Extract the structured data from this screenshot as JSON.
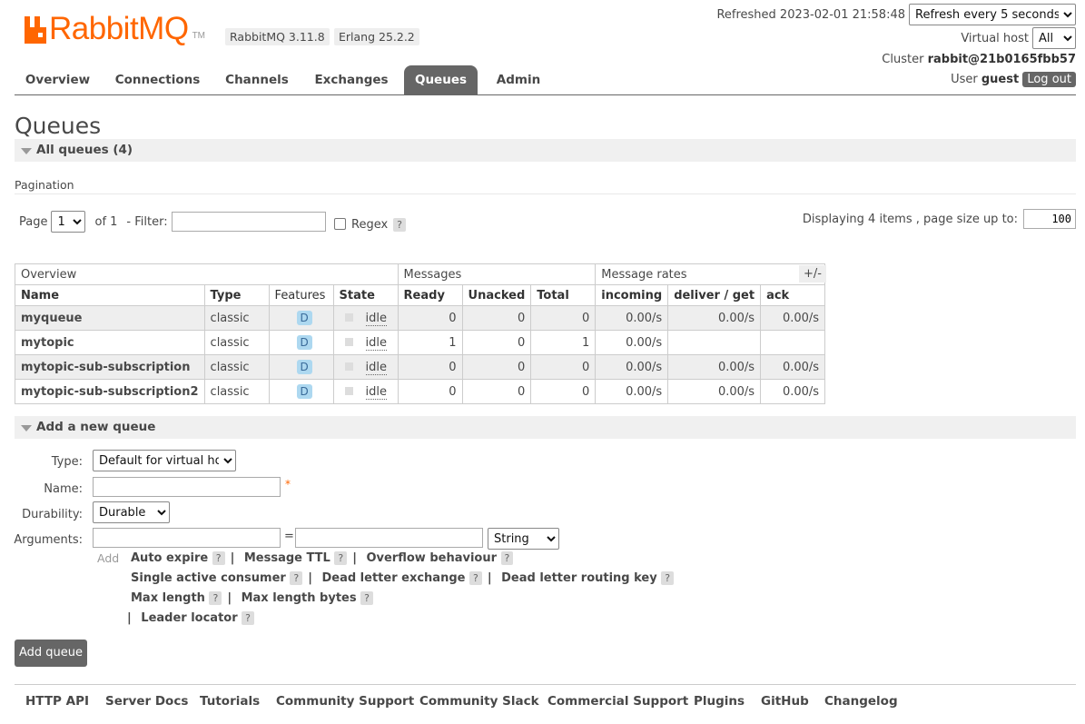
{
  "header": {
    "brand": "RabbitMQ",
    "tm": "TM",
    "rabbitmq_version": "RabbitMQ 3.11.8",
    "erlang_version": "Erlang 25.2.2",
    "refreshed": "Refreshed 2023-02-01 21:58:48",
    "refresh_option": "Refresh every 5 seconds",
    "vhost_label": "Virtual host",
    "vhost_value": "All",
    "cluster_label": "Cluster",
    "cluster_value": "rabbit@21b0165fbb57",
    "user_label": "User",
    "user_value": "guest",
    "logout": "Log out"
  },
  "tabs": [
    "Overview",
    "Connections",
    "Channels",
    "Exchanges",
    "Queues",
    "Admin"
  ],
  "active_tab": "Queues",
  "page_title": "Queues",
  "all_queues": {
    "label": "All queues (4)",
    "pagination_label": "Pagination",
    "page_label": "Page",
    "page_value": "1",
    "of_label": "of 1",
    "filter_label": "- Filter:",
    "filter_value": "",
    "regex_label": "Regex",
    "help": "?",
    "displaying": "Displaying 4 items , page size up to:",
    "page_size": "100",
    "plus_minus": "+/-"
  },
  "table": {
    "groups": [
      "Overview",
      "Messages",
      "Message rates"
    ],
    "columns": [
      "Name",
      "Type",
      "Features",
      "State",
      "Ready",
      "Unacked",
      "Total",
      "incoming",
      "deliver / get",
      "ack"
    ],
    "rows": [
      {
        "name": "myqueue",
        "type": "classic",
        "feature": "D",
        "state": "idle",
        "ready": "0",
        "unacked": "0",
        "total": "0",
        "incoming": "0.00/s",
        "deliver": "0.00/s",
        "ack": "0.00/s"
      },
      {
        "name": "mytopic",
        "type": "classic",
        "feature": "D",
        "state": "idle",
        "ready": "1",
        "unacked": "0",
        "total": "1",
        "incoming": "0.00/s",
        "deliver": "",
        "ack": ""
      },
      {
        "name": "mytopic-sub-subscription",
        "type": "classic",
        "feature": "D",
        "state": "idle",
        "ready": "0",
        "unacked": "0",
        "total": "0",
        "incoming": "0.00/s",
        "deliver": "0.00/s",
        "ack": "0.00/s"
      },
      {
        "name": "mytopic-sub-subscription2",
        "type": "classic",
        "feature": "D",
        "state": "idle",
        "ready": "0",
        "unacked": "0",
        "total": "0",
        "incoming": "0.00/s",
        "deliver": "0.00/s",
        "ack": "0.00/s"
      }
    ]
  },
  "add_queue": {
    "section_label": "Add a new queue",
    "type_label": "Type:",
    "type_value": "Default for virtual host",
    "name_label": "Name:",
    "name_value": "",
    "required_mark": "*",
    "durability_label": "Durability:",
    "durability_value": "Durable",
    "arguments_label": "Arguments:",
    "equals": "=",
    "arg_type_value": "String",
    "add_label": "Add",
    "arg_links_row1": [
      "Auto expire",
      "Message TTL",
      "Overflow behaviour"
    ],
    "arg_links_row2": [
      "Single active consumer",
      "Dead letter exchange",
      "Dead letter routing key"
    ],
    "arg_links_row3": [
      "Max length",
      "Max length bytes"
    ],
    "arg_links_row4": [
      "Leader locator"
    ],
    "submit": "Add queue"
  },
  "footer": [
    "HTTP API",
    "Server Docs",
    "Tutorials",
    "Community Support",
    "Community Slack",
    "Commercial Support",
    "Plugins",
    "GitHub",
    "Changelog"
  ],
  "colors": {
    "brand": "#ff6600",
    "tab_active": "#666666",
    "feature_badge": "#add8f0"
  }
}
